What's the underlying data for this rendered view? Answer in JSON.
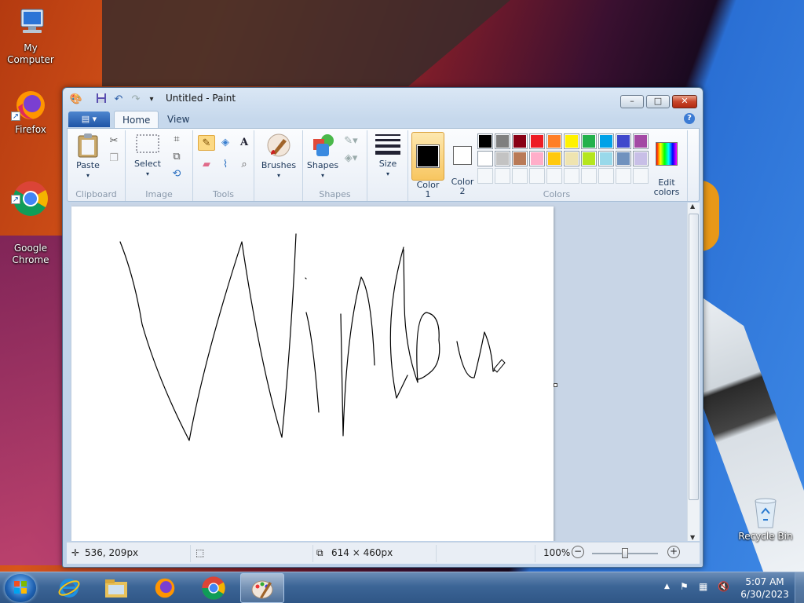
{
  "desktop": {
    "icons": [
      {
        "label": "My Computer",
        "icon": "computer-icon"
      },
      {
        "label": "Firefox",
        "icon": "firefox-icon"
      },
      {
        "label": "Google\nChrome",
        "icon": "chrome-icon"
      },
      {
        "label": "Recycle Bin",
        "icon": "recycle-bin-icon"
      }
    ]
  },
  "window": {
    "title": "Untitled - Paint",
    "quick_access": [
      "paint-app-icon",
      "save-icon",
      "undo-icon",
      "redo-icon",
      "customize-qat-icon"
    ],
    "controls": {
      "minimize": "–",
      "maximize": "□",
      "close": "✕"
    }
  },
  "ribbon": {
    "file_menu": "▤ ▾",
    "tabs": [
      "Home",
      "View"
    ],
    "active_tab": "Home",
    "help": "?",
    "groups": {
      "clipboard": {
        "label": "Clipboard",
        "paste": "Paste"
      },
      "image": {
        "label": "Image",
        "select": "Select"
      },
      "tools": {
        "label": "Tools"
      },
      "brushes": {
        "label": "Brushes"
      },
      "shapes": {
        "label": "Shapes",
        "shapes": "Shapes"
      },
      "size": {
        "label": "Size"
      },
      "color1": {
        "label": "Color\n1"
      },
      "color2": {
        "label": "Color\n2"
      },
      "colors": {
        "label": "Colors"
      },
      "edit_colors": {
        "label": "Edit\ncolors"
      }
    },
    "palette_row1": [
      "#000000",
      "#7f7f7f",
      "#880015",
      "#ed1c24",
      "#ff7f27",
      "#fff200",
      "#22b14c",
      "#00a2e8",
      "#3f48cc",
      "#a349a4"
    ],
    "palette_row2": [
      "#ffffff",
      "#c3c3c3",
      "#b97a57",
      "#ffaec9",
      "#ffc90e",
      "#efe4b0",
      "#b5e61d",
      "#99d9ea",
      "#7092be",
      "#c8bfe7"
    ],
    "color1_value": "#000000",
    "color2_value": "#ffffff"
  },
  "status": {
    "cursor_pos": "536, 209px",
    "canvas_size": "614 × 460px",
    "zoom": "100%",
    "zoom_level": 1.0
  },
  "taskbar": {
    "apps": [
      "internet-explorer-icon",
      "file-explorer-icon",
      "firefox-icon",
      "chrome-icon",
      "paint-icon"
    ],
    "active": "paint-icon",
    "time": "5:07 AM",
    "date": "6/30/2023"
  }
}
